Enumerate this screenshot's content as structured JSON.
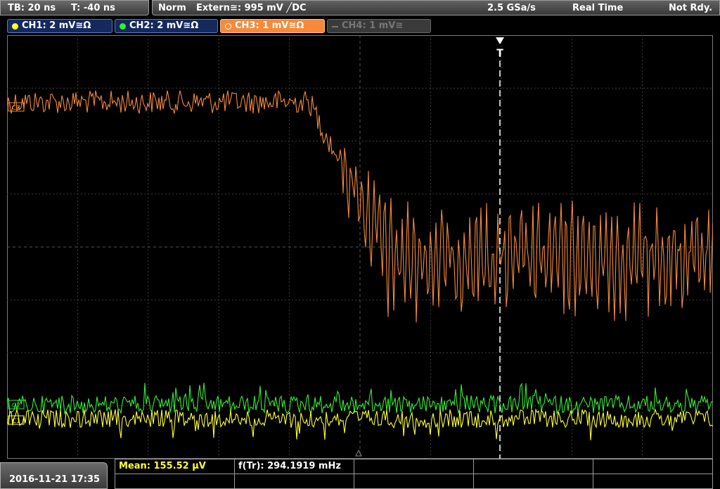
{
  "status_bar": {
    "timebase": "TB: 20 ns",
    "trigger_time": "T: -40 ns",
    "trigger_mode": "Norm",
    "trigger_source": "Extern≅: 995 mV ╱DC",
    "sample_rate": "2.5 GSa/s",
    "acquisition_mode": "Real Time",
    "state": "Not Rdy."
  },
  "channels": [
    {
      "label": "CH1: 2 mV≅Ω",
      "color": "#ffff33"
    },
    {
      "label": "CH2: 2 mV≅Ω",
      "color": "#33ee33"
    },
    {
      "label": "CH3: 1 mV≅Ω",
      "color": "#f58a3a"
    },
    {
      "label": "CH4: 1 mV≅",
      "color": "#777777"
    }
  ],
  "marker_labels": {
    "trigger": "T",
    "ch3_offset": "C3",
    "ch2_offset": "C2",
    "ch1_offset": "C1"
  },
  "measurements": {
    "mean": "Mean: 155.52 µV",
    "frequency": "f(Tr): 294.1919 mHz"
  },
  "timestamp": "2016-11-21 17:35"
}
